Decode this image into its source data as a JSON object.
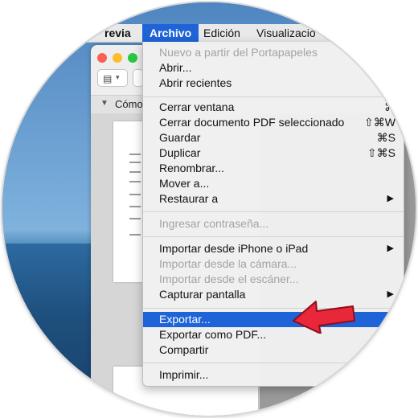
{
  "menubar": {
    "items": [
      {
        "label": "Vista previa",
        "visible": "revia"
      },
      {
        "label": "Archivo"
      },
      {
        "label": "Edición"
      },
      {
        "label": "Visualizació"
      }
    ]
  },
  "sidebar": {
    "title": "Cómo"
  },
  "file_menu": {
    "items": [
      {
        "label": "Nuevo a partir del Portapapeles",
        "shortcut": "",
        "submenu": false,
        "disabled": true
      },
      {
        "label": "Abrir...",
        "shortcut": "",
        "submenu": false,
        "disabled": false
      },
      {
        "label": "Abrir recientes",
        "shortcut": "",
        "submenu": false,
        "disabled": false
      },
      {
        "label": "Cerrar ventana",
        "shortcut": "⌘",
        "submenu": false,
        "disabled": false
      },
      {
        "label": "Cerrar documento PDF seleccionado",
        "shortcut": "⇧⌘W",
        "submenu": false,
        "disabled": false
      },
      {
        "label": "Guardar",
        "shortcut": "⌘S",
        "submenu": false,
        "disabled": false
      },
      {
        "label": "Duplicar",
        "shortcut": "⇧⌘S",
        "submenu": false,
        "disabled": false
      },
      {
        "label": "Renombrar...",
        "shortcut": "",
        "submenu": false,
        "disabled": false
      },
      {
        "label": "Mover a...",
        "shortcut": "",
        "submenu": false,
        "disabled": false
      },
      {
        "label": "Restaurar a",
        "shortcut": "",
        "submenu": true,
        "disabled": false
      },
      {
        "label": "Ingresar contraseña...",
        "shortcut": "",
        "submenu": false,
        "disabled": true
      },
      {
        "label": "Importar desde iPhone o iPad",
        "shortcut": "",
        "submenu": true,
        "disabled": false
      },
      {
        "label": "Importar desde la cámara...",
        "shortcut": "",
        "submenu": false,
        "disabled": true
      },
      {
        "label": "Importar desde el escáner...",
        "shortcut": "",
        "submenu": false,
        "disabled": true
      },
      {
        "label": "Capturar pantalla",
        "shortcut": "",
        "submenu": true,
        "disabled": false
      },
      {
        "label": "Exportar...",
        "shortcut": "",
        "submenu": false,
        "disabled": false,
        "highlighted": true
      },
      {
        "label": "Exportar como PDF...",
        "shortcut": "",
        "submenu": false,
        "disabled": false
      },
      {
        "label": "Compartir",
        "shortcut": "",
        "submenu": false,
        "disabled": false
      },
      {
        "label": "Imprimir...",
        "shortcut": "",
        "submenu": false,
        "disabled": false
      }
    ]
  },
  "colors": {
    "highlight": "#1f63d8",
    "arrow": "#e8283a",
    "disabled_text": "#a3a3a3"
  },
  "icons": {
    "submenu": "chevron-right-icon",
    "annotation": "red-arrow-icon"
  }
}
